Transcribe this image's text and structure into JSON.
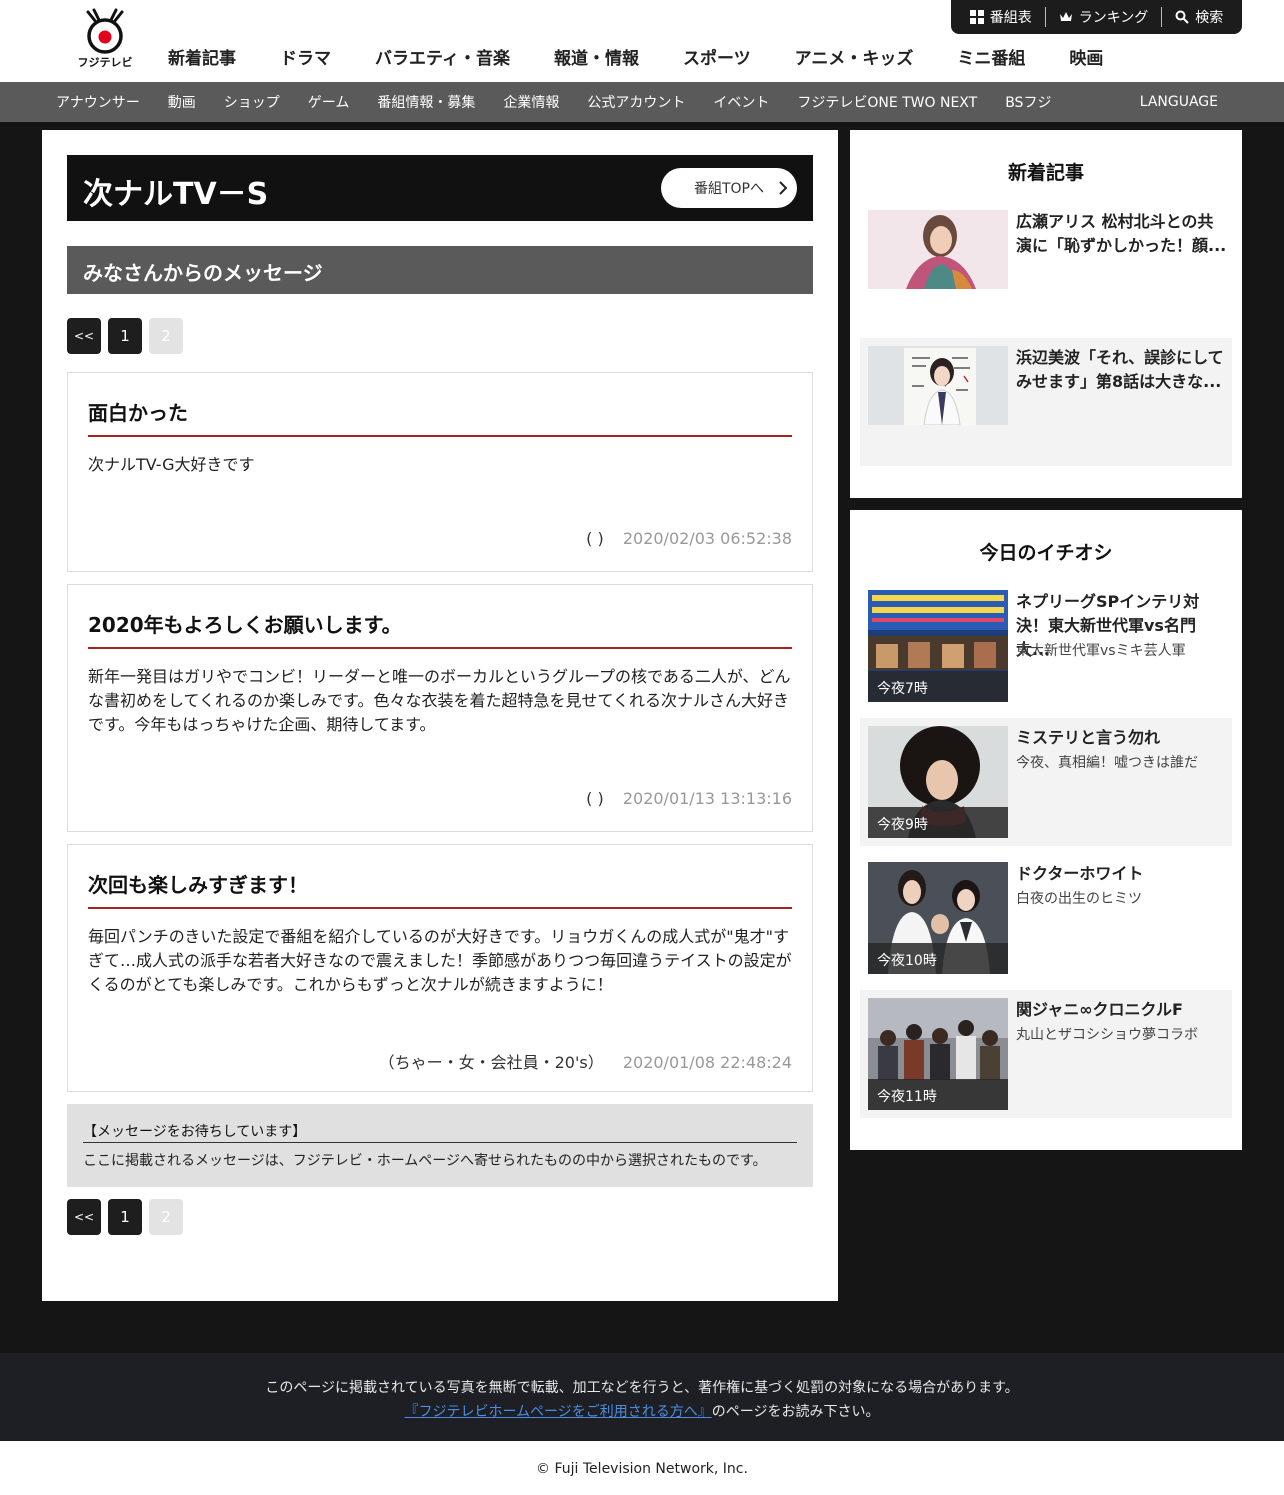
{
  "header": {
    "logo_text": "フジテレビ",
    "nav": [
      "新着記事",
      "ドラマ",
      "バラエティ・音楽",
      "報道・情報",
      "スポーツ",
      "アニメ・キッズ",
      "ミニ番組",
      "映画"
    ],
    "util": {
      "schedule": "番組表",
      "ranking": "ランキング",
      "search": "検索"
    }
  },
  "subnav": {
    "items": [
      "アナウンサー",
      "動画",
      "ショップ",
      "ゲーム",
      "番組情報・募集",
      "企業情報",
      "公式アカウント",
      "イベント",
      "フジテレビONE TWO NEXT",
      "BSフジ"
    ],
    "language": "LANGUAGE"
  },
  "program": {
    "title": "次ナルTV－S",
    "top_button": "番組TOPへ"
  },
  "section_title": "みなさんからのメッセージ",
  "pager": {
    "prev": "<<",
    "page1": "1",
    "page2": "2"
  },
  "messages": [
    {
      "title": "面白かった",
      "body": "次ナルTV-G大好きです",
      "author": "( )",
      "date": "2020/02/03 06:52:38"
    },
    {
      "title": "2020年もよろしくお願いします。",
      "body": "新年一発目はガリやでコンビ！リーダーと唯一のボーカルというグループの核である二人が、どんな書初めをしてくれるのか楽しみです。色々な衣装を着た超特急を見せてくれる次ナルさん大好きです。今年もはっちゃけた企画、期待してます。",
      "author": "( )",
      "date": "2020/01/13 13:13:16"
    },
    {
      "title": "次回も楽しみすぎます！",
      "body": "毎回パンチのきいた設定で番組を紹介しているのが大好きです。リョウガくんの成人式が\"鬼才\"すぎて…成人式の派手な若者大好きなので震えました！季節感がありつつ毎回違うテイストの設定がくるのがとても楽しみです。これからもずっと次ナルが続きますように！",
      "author": "（ちゃー・女・会社員・20's）",
      "date": "2020/01/08 22:48:24"
    }
  ],
  "notice": {
    "title": "【メッセージをお待ちしています】",
    "text": "ここに掲載されるメッセージは、フジテレビ・ホームページへ寄せられたものの中から選択されたものです。"
  },
  "sidebar": {
    "news_title": "新着記事",
    "news": [
      {
        "title": "広瀬アリス 松村北斗との共演に「恥ずかしかった！顔..."
      },
      {
        "title": "浜辺美波「それ、誤診にしてみせます」第8話は大きな..."
      }
    ],
    "pick_title": "今日のイチオシ",
    "picks": [
      {
        "time": "今夜7時",
        "title": "ネプリーグSPインテリ対決！東大新世代軍vs名門大...",
        "sub": "東大新世代軍vsミキ芸人軍"
      },
      {
        "time": "今夜9時",
        "title": "ミステリと言う勿れ",
        "sub": "今夜、真相編！嘘つきは誰だ"
      },
      {
        "time": "今夜10時",
        "title": "ドクターホワイト",
        "sub": "白夜の出生のヒミツ"
      },
      {
        "time": "今夜11時",
        "title": "関ジャニ∞クロニクルF",
        "sub": "丸山とザコシショウ夢コラボ"
      }
    ]
  },
  "footer": {
    "line1": "このページに掲載されている写真を無断で転載、加工などを行うと、著作権に基づく処罰の対象になる場合があります。",
    "link": "『フジテレビホームページをご利用される方へ』",
    "line2_suffix": "のページをお読み下さい。",
    "copyright": "© Fuji Television Network, Inc."
  },
  "colors": {
    "accent_rule": "#a8221e",
    "dark": "#111111",
    "section_gray": "#5a5a5a",
    "link": "#4d8de0"
  }
}
